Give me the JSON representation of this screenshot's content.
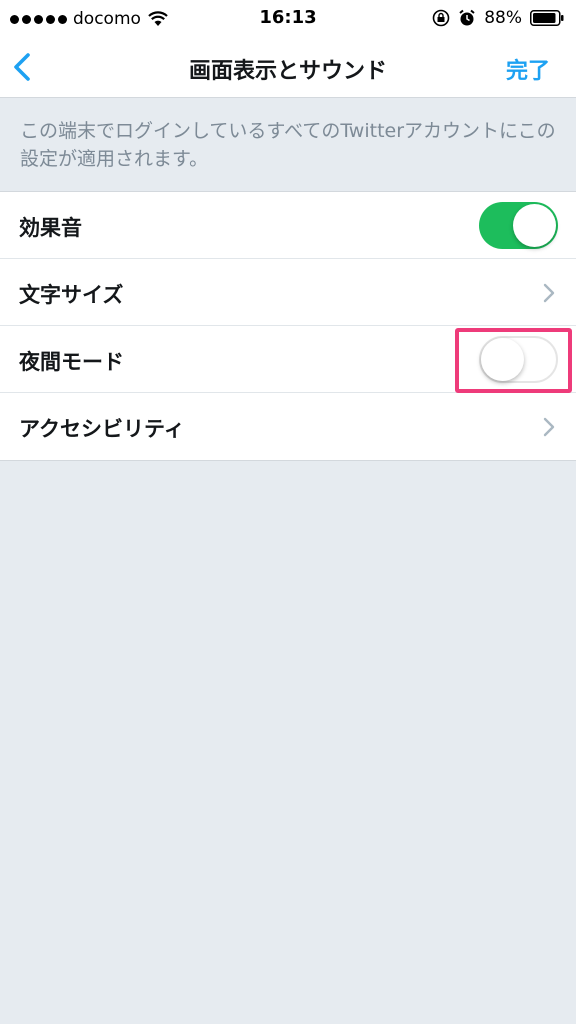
{
  "status_bar": {
    "carrier": "docomo",
    "time": "16:13",
    "battery": "88%"
  },
  "nav": {
    "title": "画面表示とサウンド",
    "done_label": "完了"
  },
  "description": "この端末でログインしているすべてのTwitterアカウントにこの設定が適用されます。",
  "settings": [
    {
      "label": "効果音",
      "control": "toggle",
      "on": true
    },
    {
      "label": "文字サイズ",
      "control": "chevron"
    },
    {
      "label": "夜間モード",
      "control": "toggle",
      "on": false
    },
    {
      "label": "アクセシビリティ",
      "control": "chevron"
    }
  ],
  "colors": {
    "accent": "#1da1f2",
    "toggle_on": "#1dbd5c",
    "highlight": "#ee3b7a",
    "background": "#e6ebf0"
  }
}
